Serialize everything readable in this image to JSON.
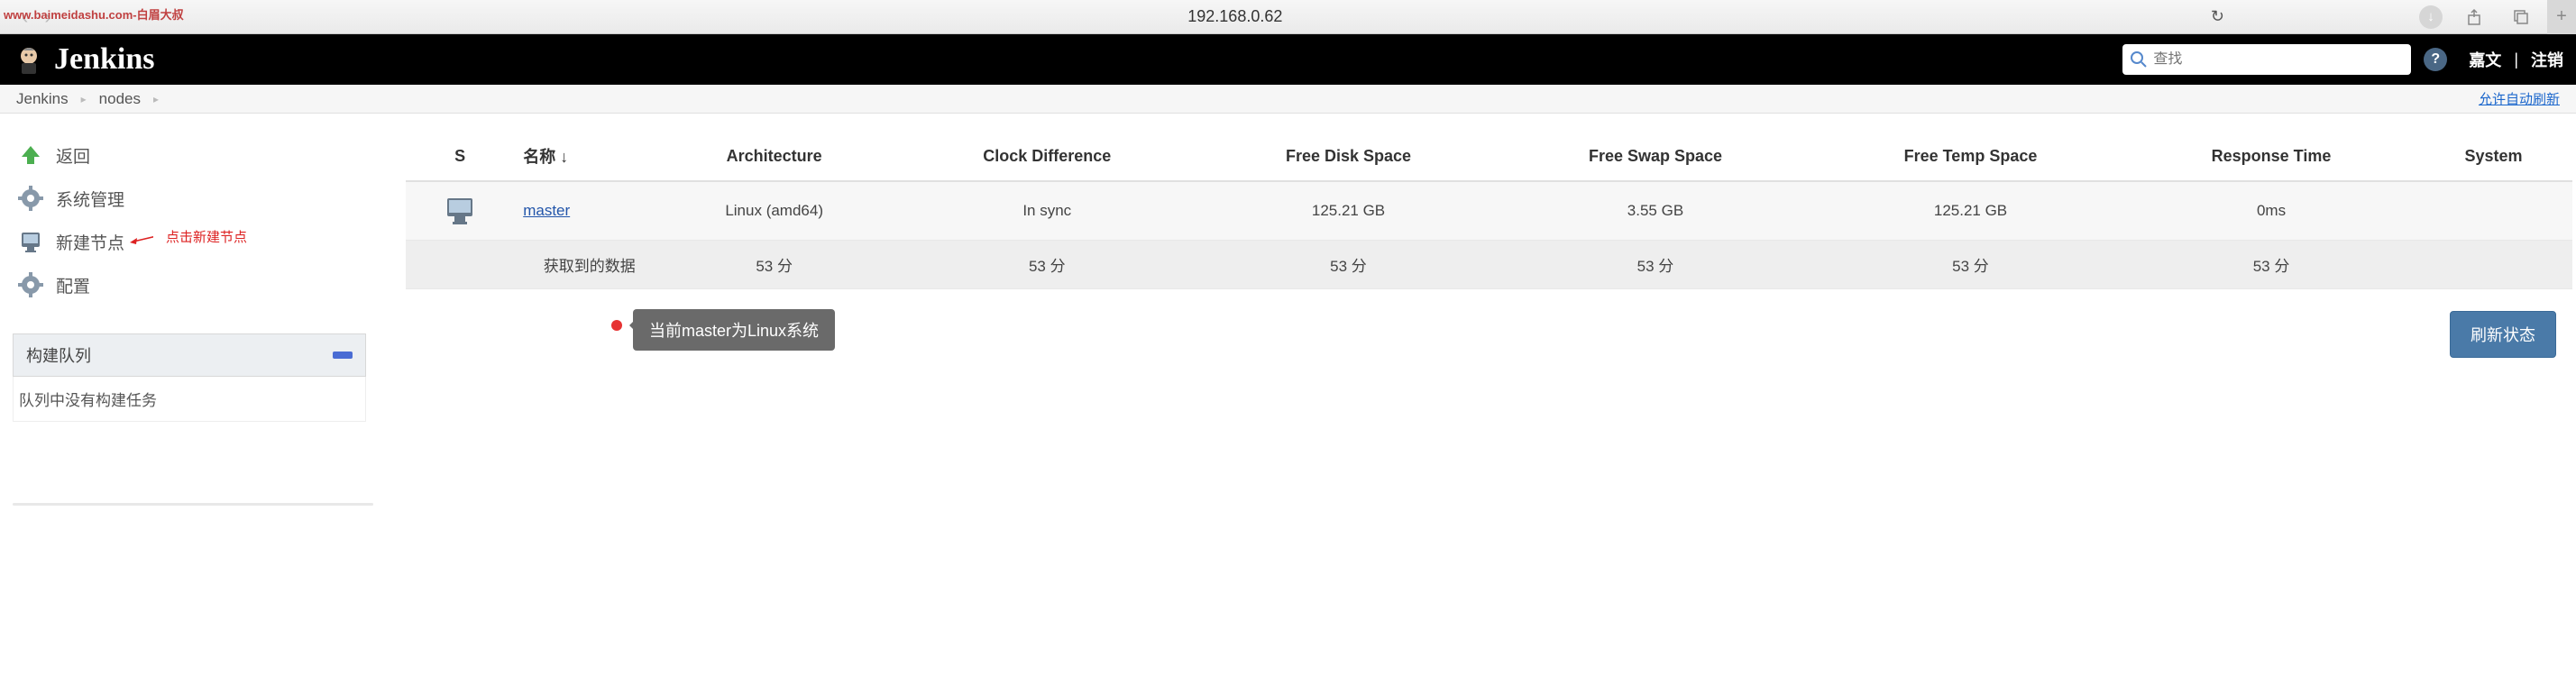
{
  "watermark": "www.baimeidashu.com-白眉大叔",
  "browser": {
    "url": "192.168.0.62"
  },
  "header": {
    "logo_text": "Jenkins",
    "search_placeholder": "查找",
    "help": "?",
    "user": "嘉文",
    "logout": "注销"
  },
  "breadcrumb": {
    "items": [
      "Jenkins",
      "nodes"
    ],
    "right_link": "允许自动刷新"
  },
  "sidebar": {
    "items": [
      {
        "icon": "up-arrow",
        "label": "返回"
      },
      {
        "icon": "gear",
        "label": "系统管理"
      },
      {
        "icon": "computer",
        "label": "新建节点"
      },
      {
        "icon": "gear",
        "label": "配置"
      }
    ],
    "annotation": "点击新建节点",
    "build_queue": {
      "title": "构建队列",
      "empty": "队列中没有构建任务"
    }
  },
  "table": {
    "columns": [
      "S",
      "名称 ↓",
      "Architecture",
      "Clock Difference",
      "Free Disk Space",
      "Free Swap Space",
      "Free Temp Space",
      "Response Time",
      "System"
    ],
    "row": {
      "name": "master",
      "arch": "Linux (amd64)",
      "clock": "In sync",
      "disk": "125.21 GB",
      "swap": "3.55 GB",
      "temp": "125.21 GB",
      "response": "0ms"
    },
    "summary": {
      "label": "获取到的数据",
      "v1": "53 分",
      "v2": "53 分",
      "v3": "53 分",
      "v4": "53 分",
      "v5": "53 分",
      "v6": "53 分"
    }
  },
  "callout": "当前master为Linux系统",
  "refresh_button": "刷新状态"
}
